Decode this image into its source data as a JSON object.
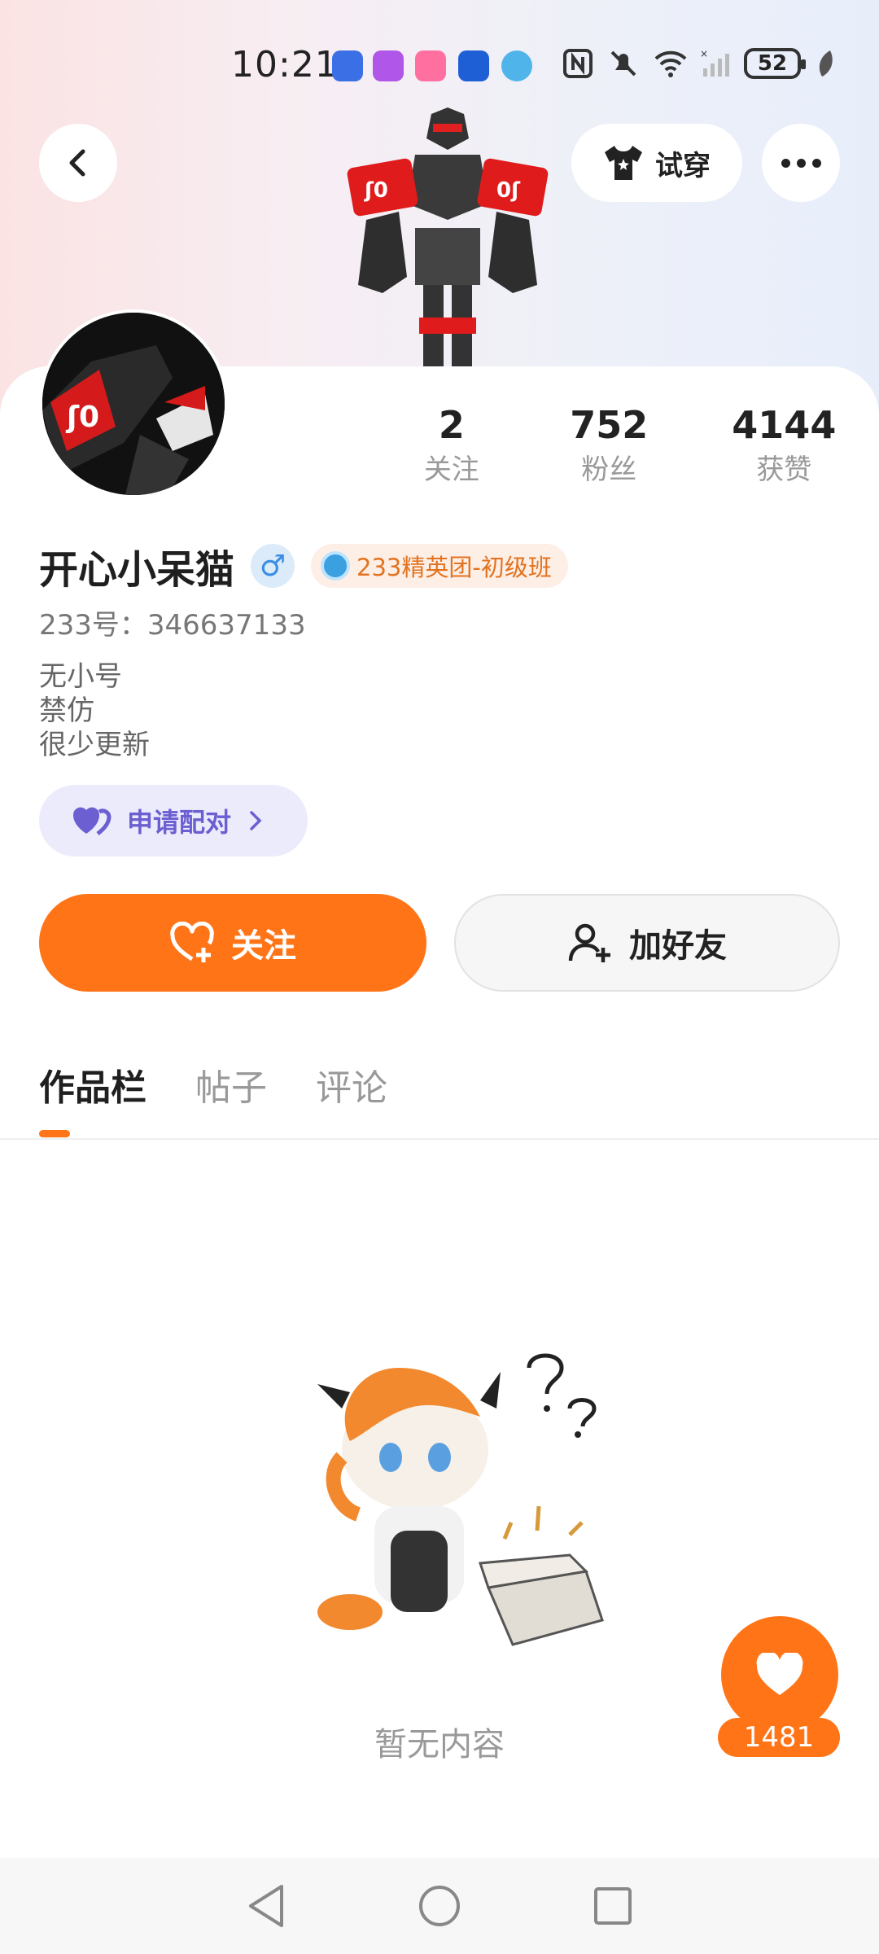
{
  "status_bar": {
    "time": "10:21",
    "battery": "52",
    "icons": [
      "nfc-icon",
      "mute-icon",
      "wifi-icon",
      "signal-icon",
      "battery-icon",
      "leaf-icon"
    ]
  },
  "header": {
    "try_on_label": "试穿"
  },
  "profile": {
    "stats": [
      {
        "value": "2",
        "label": "关注"
      },
      {
        "value": "752",
        "label": "粉丝"
      },
      {
        "value": "4144",
        "label": "获赞"
      }
    ],
    "username": "开心小呆猫",
    "gender_symbol": "♂",
    "level_badge": "233精英团-初级班",
    "uid": "233号：346637133",
    "bio_lines": [
      "无小号",
      "禁仿",
      "很少更新"
    ],
    "pair_label": "申请配对"
  },
  "actions": {
    "follow_label": "关注",
    "add_friend_label": "加好友"
  },
  "tabs": [
    {
      "label": "作品栏",
      "active": true
    },
    {
      "label": "帖子",
      "active": false
    },
    {
      "label": "评论",
      "active": false
    }
  ],
  "content": {
    "empty_text": "暂无内容"
  },
  "like_fab": {
    "count": "1481"
  },
  "colors": {
    "accent": "#ff7417",
    "pair_purple": "#6b5fd1"
  }
}
